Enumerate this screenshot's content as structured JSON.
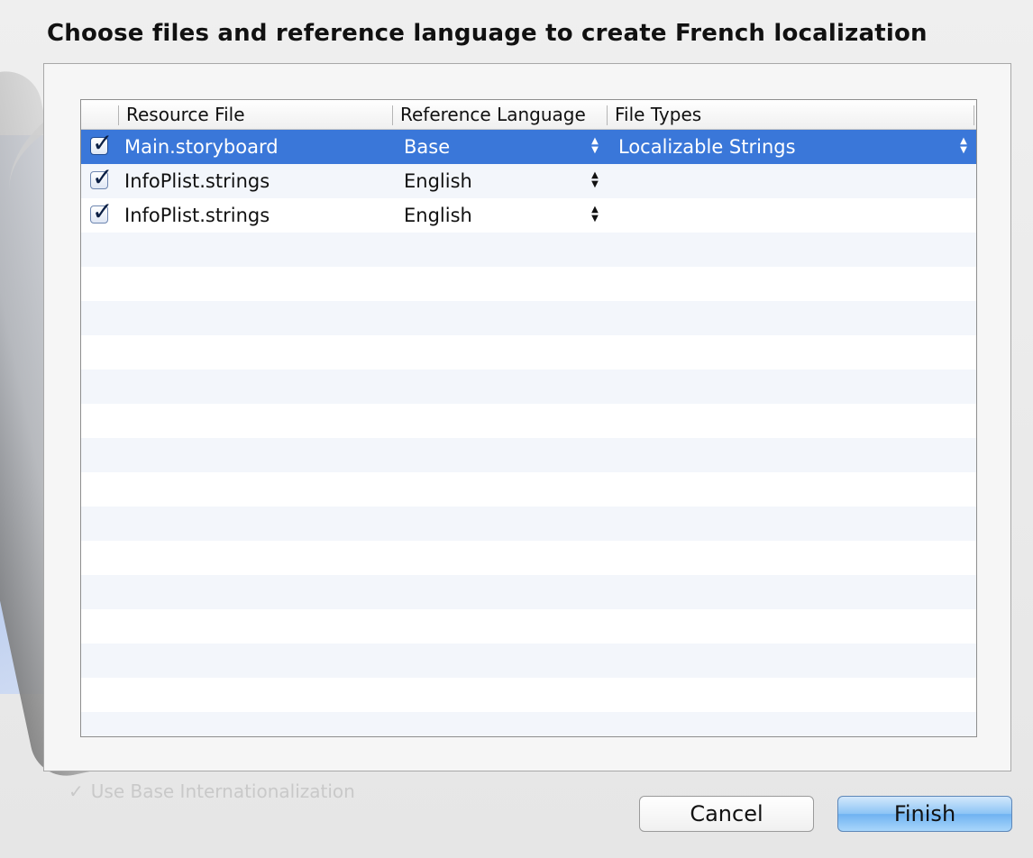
{
  "dialog": {
    "title": "Choose files and reference language to create French localization"
  },
  "table": {
    "columns": [
      "",
      "Resource File",
      "Reference Language",
      "File Types"
    ],
    "rows": [
      {
        "checked": true,
        "file": "Main.storyboard",
        "language": "Base",
        "file_type": "Localizable Strings",
        "selected": true
      },
      {
        "checked": true,
        "file": "InfoPlist.strings",
        "language": "English",
        "file_type": "",
        "selected": false
      },
      {
        "checked": true,
        "file": "InfoPlist.strings",
        "language": "English",
        "file_type": "",
        "selected": false
      }
    ]
  },
  "options": {
    "use_base_internationalization_label": "Use Base Internationalization"
  },
  "buttons": {
    "cancel": "Cancel",
    "finish": "Finish"
  },
  "glyphs": {
    "check": "✓",
    "stepper": "▲\n▼"
  },
  "colors": {
    "selection": "#3a77d9",
    "stripe": "#f3f6fb",
    "finish_button": "#8cc4f5"
  }
}
